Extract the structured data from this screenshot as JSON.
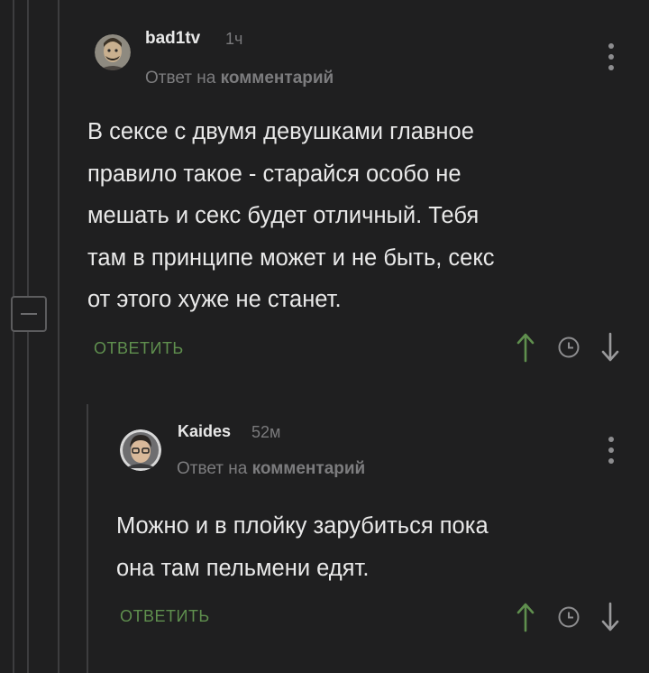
{
  "comments": [
    {
      "author": "bad1tv",
      "time": "1ч",
      "reply_prefix": "Ответ на",
      "reply_target": "комментарий",
      "lines": [
        "В сексе с двумя девушками главное",
        "правило такое - старайся особо не",
        "мешать и секс будет отличный. Тебя",
        "там в принципе может и не быть, секс",
        "от этого хуже не станет."
      ],
      "reply_label": "ОТВЕТИТЬ"
    },
    {
      "author": "Kaides",
      "time": "52м",
      "reply_prefix": "Ответ на",
      "reply_target": "комментарий",
      "lines": [
        "Можно и в плойку зарубиться пока",
        "она там пельмени едят."
      ],
      "reply_label": "ОТВЕТИТЬ"
    }
  ],
  "icons": {
    "upvote": "arrow-up-icon",
    "save": "clock-icon",
    "downvote": "arrow-down-icon",
    "menu": "more-vertical-icon",
    "collapse": "minus-square-icon"
  },
  "colors": {
    "background": "#1f1f20",
    "upvote": "#5f8f4e",
    "reply": "#5f8f4e",
    "muted": "#7a7a7c"
  }
}
